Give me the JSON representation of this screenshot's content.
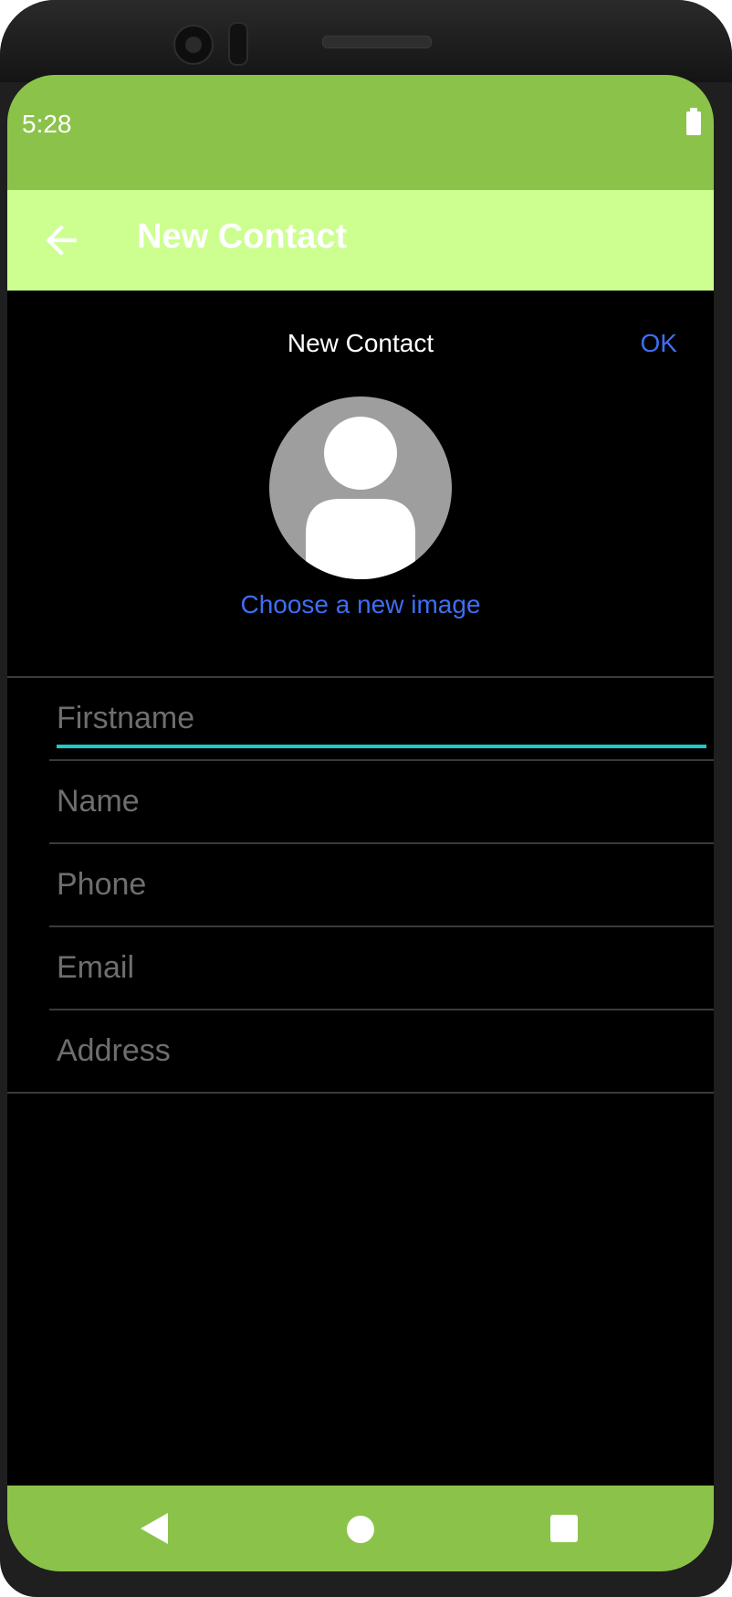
{
  "status_bar": {
    "time": "5:28",
    "battery_icon": "battery-icon"
  },
  "app_bar": {
    "back_icon": "arrow-back-icon",
    "title": "New Contact"
  },
  "form_header": {
    "title": "New Contact",
    "ok_label": "OK"
  },
  "avatar": {
    "icon": "person-icon",
    "choose_image_label": "Choose a new image"
  },
  "fields": [
    {
      "placeholder": "Firstname",
      "value": ""
    },
    {
      "placeholder": "Name",
      "value": ""
    },
    {
      "placeholder": "Phone",
      "value": ""
    },
    {
      "placeholder": "Email",
      "value": ""
    },
    {
      "placeholder": "Address",
      "value": ""
    }
  ],
  "nav_bar": {
    "back_icon": "triangle-back-icon",
    "home_icon": "circle-home-icon",
    "recents_icon": "square-recents-icon"
  },
  "colors": {
    "status_bar": "#8bc34a",
    "app_bar": "#ccff90",
    "accent_link": "#3d6ef5",
    "focus_underline": "#1ec8c8",
    "background": "#000000"
  }
}
